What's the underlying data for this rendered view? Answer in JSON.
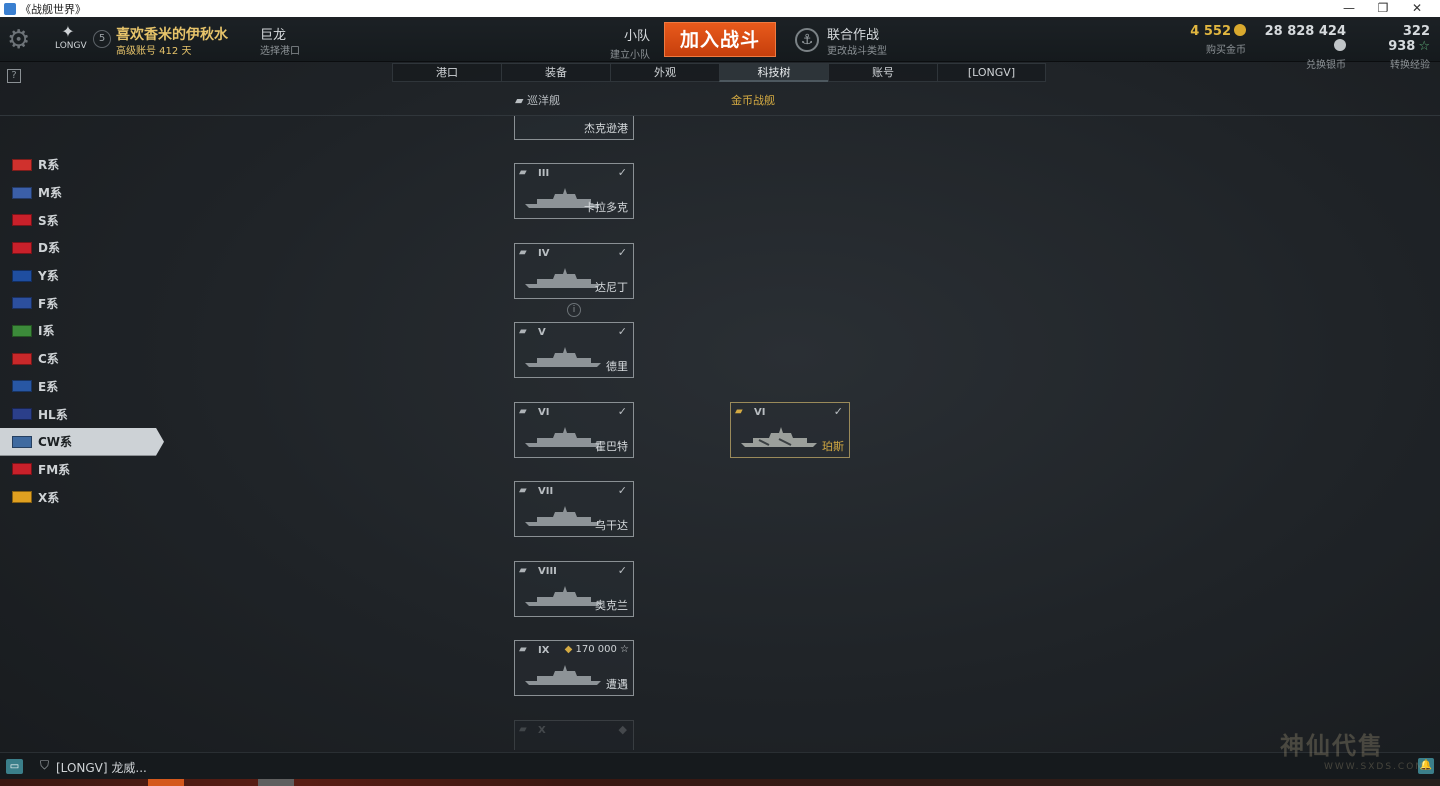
{
  "window": {
    "title": "《战舰世界》",
    "controls": [
      "—",
      "❐",
      "✕"
    ]
  },
  "player": {
    "name": "喜欢香米的伊秋水",
    "account_status": "高级账号  412 天",
    "level": "5",
    "clan_tag": "LONGV"
  },
  "port": {
    "name": "巨龙",
    "action": "选择港口"
  },
  "squad": {
    "title": "小队",
    "action": "建立小队"
  },
  "battle_button": "加入战斗",
  "mode": {
    "title": "联合作战",
    "action": "更改战斗类型"
  },
  "currencies": [
    {
      "value": "4 552",
      "label": "购买金币",
      "color": "#e0b640"
    },
    {
      "value": "28 828 424",
      "label": "兑换银币",
      "color": "#d6dadd"
    },
    {
      "value": "322 938",
      "label": "转换经验",
      "color": "#d6dadd"
    }
  ],
  "help": "?",
  "tabs": [
    "港口",
    "装备",
    "外观",
    "科技树",
    "账号",
    "[LONGV]"
  ],
  "active_tab": "科技树",
  "subheader": {
    "class_label": "巡洋舰",
    "premium_label": "金币战舰"
  },
  "nations": [
    {
      "label": "R系",
      "color": "#d0312d"
    },
    {
      "label": "M系",
      "color": "#3b5fa8"
    },
    {
      "label": "S系",
      "color": "#c8202a"
    },
    {
      "label": "D系",
      "color": "#c8202a"
    },
    {
      "label": "Y系",
      "color": "#1f4ea0"
    },
    {
      "label": "F系",
      "color": "#2c4f9e"
    },
    {
      "label": "I系",
      "color": "#3c8a3a"
    },
    {
      "label": "C系",
      "color": "#c8282a"
    },
    {
      "label": "E系",
      "color": "#2857a4"
    },
    {
      "label": "HL系",
      "color": "#2b3f8a"
    },
    {
      "label": "CW系",
      "color": "#3f6aa0"
    },
    {
      "label": "FM系",
      "color": "#c8202a"
    },
    {
      "label": "X系",
      "color": "#e0a020"
    }
  ],
  "active_nation": "CW系",
  "ships": [
    {
      "tier": "",
      "name": "杰克逊港",
      "check": "",
      "xp": ""
    },
    {
      "tier": "III",
      "name": "卡拉多克",
      "check": "✓",
      "xp": ""
    },
    {
      "tier": "IV",
      "name": "达尼丁",
      "check": "✓",
      "xp": ""
    },
    {
      "tier": "V",
      "name": "德里",
      "check": "✓",
      "xp": ""
    },
    {
      "tier": "VI",
      "name": "霍巴特",
      "check": "✓",
      "xp": ""
    },
    {
      "tier": "VII",
      "name": "乌干达",
      "check": "✓",
      "xp": ""
    },
    {
      "tier": "VIII",
      "name": "奥克兰",
      "check": "✓",
      "xp": ""
    },
    {
      "tier": "IX",
      "name": "遭遇",
      "check": "",
      "xp": "170 000 ☆"
    },
    {
      "tier": "X",
      "name": "",
      "check": "",
      "xp": ""
    }
  ],
  "premium_ship": {
    "tier": "VI",
    "name": "珀斯",
    "check": "✓"
  },
  "info_icon": "i",
  "chat": {
    "tag": "[LONGV]",
    "message": "龙威..."
  },
  "watermark": {
    "text": "神仙代售",
    "url": "WWW.SXDS.COM"
  }
}
